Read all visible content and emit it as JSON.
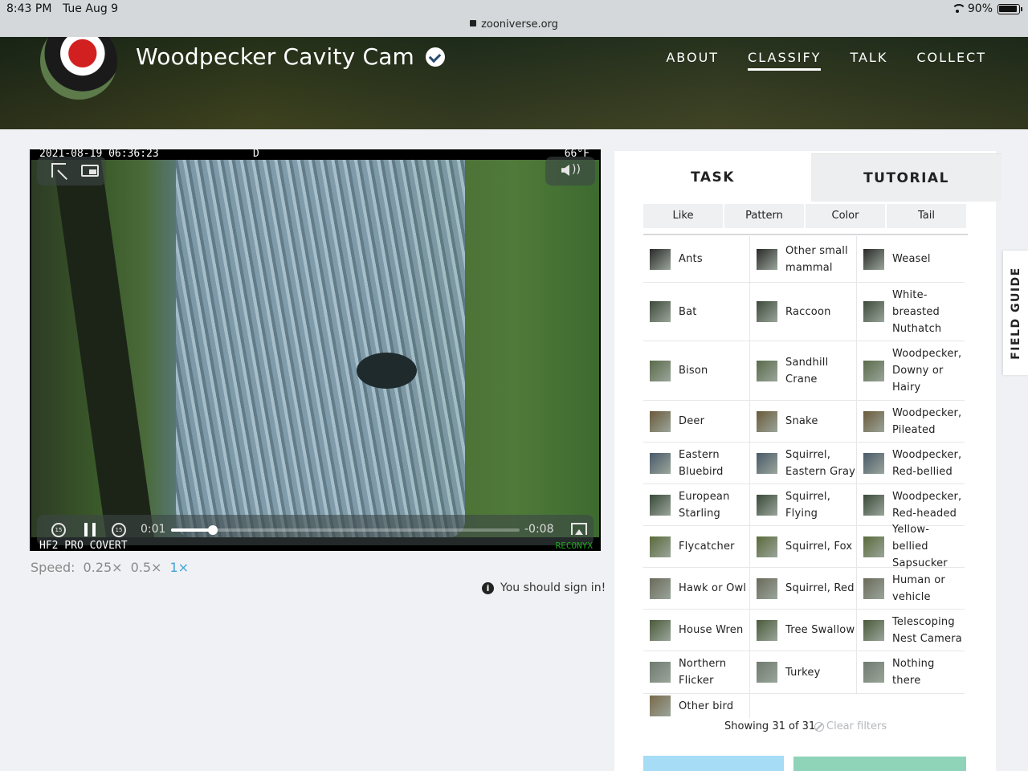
{
  "status_bar": {
    "time": "8:43 PM",
    "date": "Tue Aug 9",
    "url": "zooniverse.org",
    "battery": "90%"
  },
  "header": {
    "title": "Woodpecker Cavity Cam",
    "nav": [
      {
        "label": "ABOUT",
        "active": false
      },
      {
        "label": "CLASSIFY",
        "active": true
      },
      {
        "label": "TALK",
        "active": false
      },
      {
        "label": "COLLECT",
        "active": false
      }
    ]
  },
  "video": {
    "timestamp": "2021-08-19 06:36:23",
    "flag": "D",
    "temperature": "66°F",
    "camera_model": "HF2 PRO COVERT",
    "brand": "RECONYX",
    "current_time": "0:01",
    "remaining_time": "-0:08",
    "progress_fraction": 0.12,
    "skip_back": "15",
    "skip_fwd": "15"
  },
  "speed": {
    "label": "Speed:",
    "options": [
      {
        "label": "0.25×",
        "selected": false
      },
      {
        "label": "0.5×",
        "selected": false
      },
      {
        "label": "1×",
        "selected": true
      }
    ]
  },
  "signin_notice": "You should sign in!",
  "tabs": {
    "task": "TASK",
    "tutorial": "TUTORIAL"
  },
  "filters": [
    "Like",
    "Pattern",
    "Color",
    "Tail"
  ],
  "species": [
    [
      "Ants",
      "Other small mammal",
      "Weasel"
    ],
    [
      "Bat",
      "Raccoon",
      "White-breasted Nuthatch"
    ],
    [
      "Bison",
      "Sandhill Crane",
      "Woodpecker, Downy or Hairy"
    ],
    [
      "Deer",
      "Snake",
      "Woodpecker, Pileated"
    ],
    [
      "Eastern Bluebird",
      "Squirrel, Eastern Gray",
      "Woodpecker, Red-bellied"
    ],
    [
      "European Starling",
      "Squirrel, Flying",
      "Woodpecker, Red-headed"
    ],
    [
      "Flycatcher",
      "Squirrel, Fox",
      "Yellow-bellied Sapsucker"
    ],
    [
      "Hawk or Owl",
      "Squirrel, Red",
      "Human or vehicle"
    ],
    [
      "House Wren",
      "Tree Swallow",
      "Telescoping Nest Camera"
    ],
    [
      "Northern Flicker",
      "Turkey",
      "Nothing there"
    ],
    [
      "Other bird"
    ]
  ],
  "showing": "Showing 31 of 31",
  "clear_filters": "Clear filters",
  "field_guide": "FIELD GUIDE",
  "colors": {
    "accent_blue": "#3ea3d6",
    "done_button": "#a6dcf5",
    "next_button": "#8fd3b8"
  }
}
